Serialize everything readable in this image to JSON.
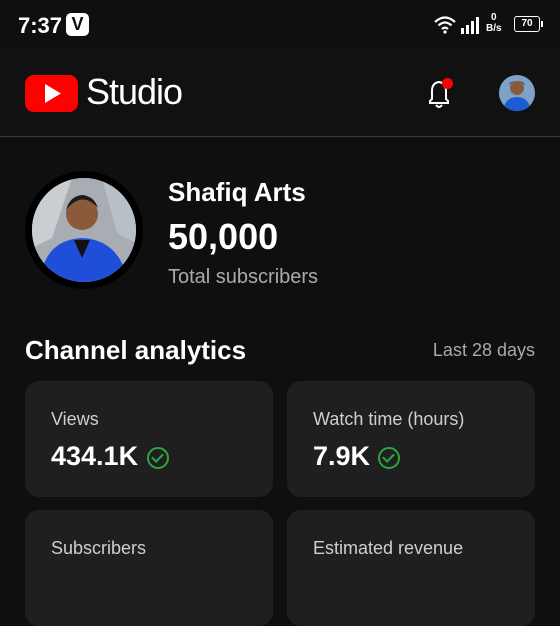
{
  "status_bar": {
    "time": "7:37",
    "app_badge": "V",
    "net_speed_value": "0",
    "net_speed_unit": "B/s",
    "battery": "70"
  },
  "header": {
    "title": "Studio",
    "brand_color": "#ff0000"
  },
  "channel": {
    "name": "Shafiq Arts",
    "subscribers": "50,000",
    "subscribers_label": "Total subscribers"
  },
  "analytics": {
    "title": "Channel analytics",
    "period": "Last 28 days",
    "cards": [
      {
        "label": "Views",
        "value": "434.1K",
        "icon": "check-circle-icon"
      },
      {
        "label": "Watch time (hours)",
        "value": "7.9K",
        "icon": "check-circle-icon"
      },
      {
        "label": "Subscribers",
        "value": ""
      },
      {
        "label": "Estimated revenue",
        "value": ""
      }
    ],
    "status_color": "#2ba640"
  }
}
